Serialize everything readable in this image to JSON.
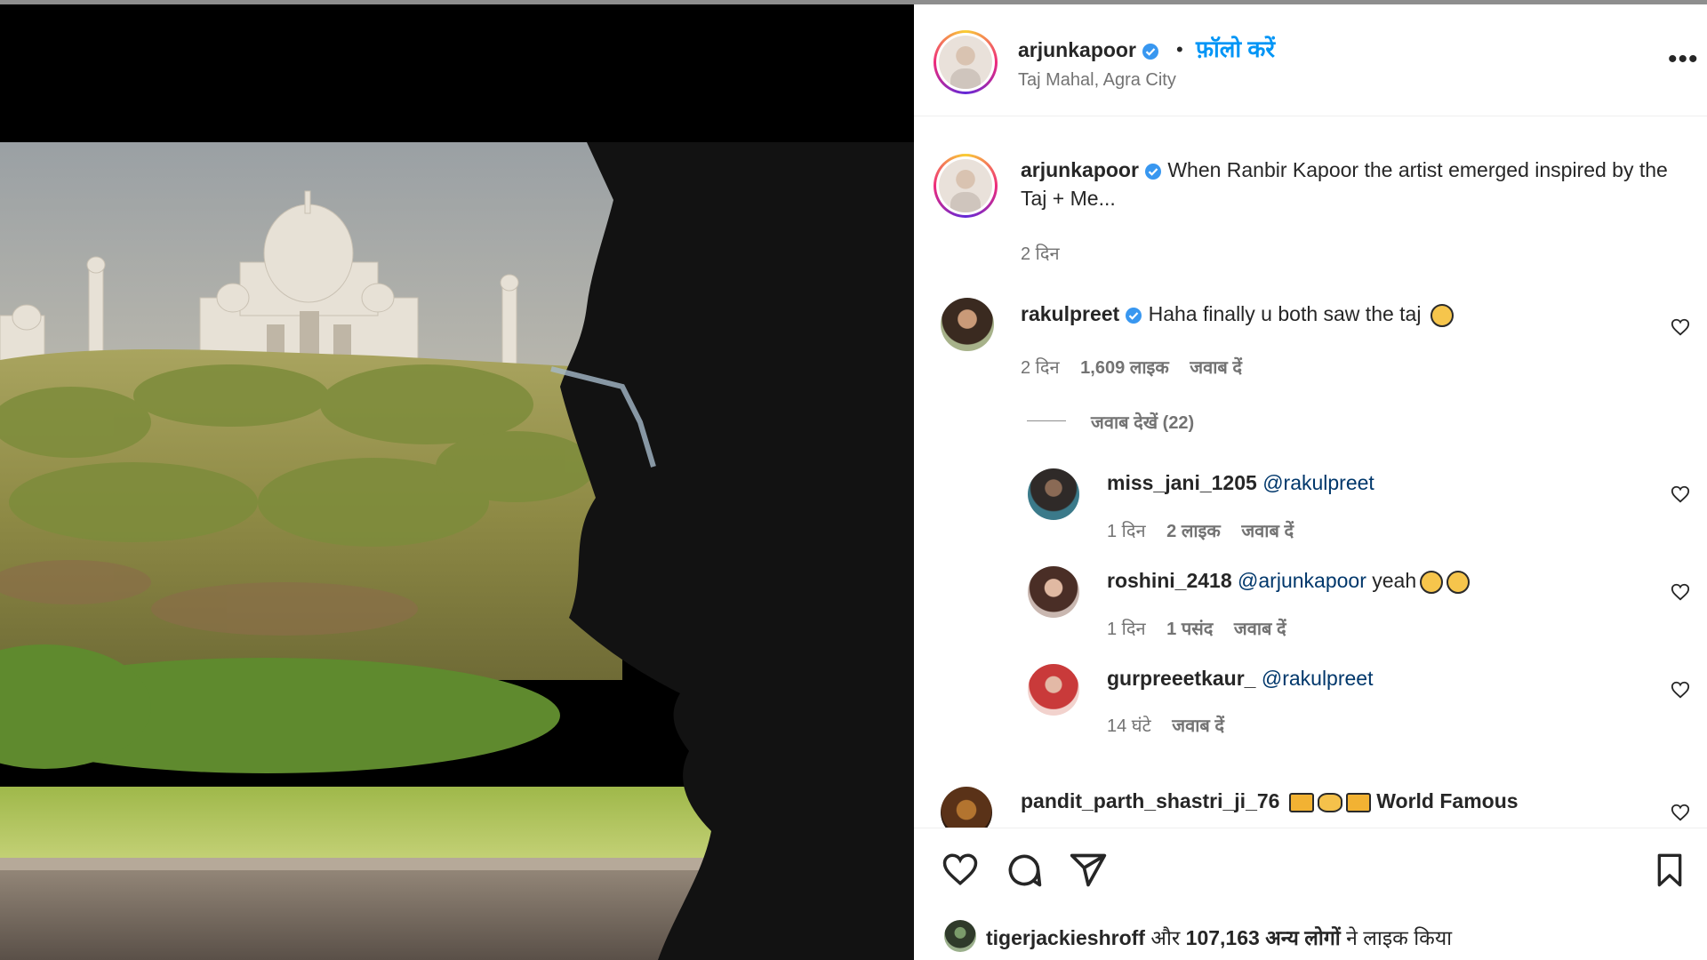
{
  "post": {
    "author": "arjunkapoor",
    "follow_label": "फ़ॉलो करें",
    "separator": "•",
    "location": "Taj Mahal, Agra City",
    "more_label": "•••",
    "caption": "When Ranbir Kapoor the artist emerged inspired by the Taj + Me...",
    "caption_time": "2 दिन"
  },
  "comments": [
    {
      "user": "rakulpreet",
      "text": "Haha finally u both saw the taj",
      "time": "2 दिन",
      "likes": "1,609 लाइक",
      "reply": "जवाब दें",
      "view_replies": "जवाब देखें (22)"
    }
  ],
  "replies": [
    {
      "user": "miss_jani_1205",
      "mention": "@rakulpreet",
      "text": "",
      "time": "1 दिन",
      "likes": "2 लाइक",
      "reply": "जवाब दें"
    },
    {
      "user": "roshini_2418",
      "mention": "@arjunkapoor",
      "text": "yeah",
      "time": "1 दिन",
      "likes": "1 पसंद",
      "reply": "जवाब दें"
    },
    {
      "user": "gurpreeetkaur_",
      "mention": "@rakulpreet",
      "text": "",
      "time": "14 घंटे",
      "likes": "",
      "reply": "जवाब दें"
    }
  ],
  "last_comment": {
    "user": "pandit_parth_shastri_ji_76",
    "text": "World Famous"
  },
  "footer": {
    "liked_by_user": "tigerjackieshroff",
    "liked_by_rest": "और",
    "liked_count": "107,163 अन्य लोगों",
    "liked_suffix": "ने लाइक किया"
  },
  "icons": {
    "like": "heart-icon",
    "comment": "comment-icon",
    "share": "send-icon",
    "save": "bookmark-icon",
    "verified": "verified-badge-icon"
  },
  "colors": {
    "follow": "#0095f6",
    "verified": "#3897f0",
    "mention": "#00376b",
    "muted": "#737373"
  }
}
